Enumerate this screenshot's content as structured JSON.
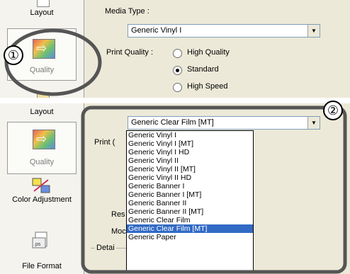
{
  "top": {
    "sidebar": {
      "layout_label": "Layout",
      "quality_label": "Quality"
    },
    "media_type_label": "Media Type :",
    "media_type_value": "Generic Vinyl I",
    "print_quality_label": "Print Quality :",
    "quality_options": [
      "High Quality",
      "Standard",
      "High Speed"
    ],
    "selected_quality": "Standard"
  },
  "bottom": {
    "sidebar": {
      "layout_label": "Layout",
      "quality_label": "Quality",
      "color_label": "Color Adjustment",
      "file_label": "File Format"
    },
    "selected_value": "Generic Clear Film [MT]",
    "media_options": [
      "Generic Vinyl I",
      "Generic Vinyl I [MT]",
      "Generic Vinyl I HD",
      "Generic Vinyl II",
      "Generic Vinyl II [MT]",
      "Generic Vinyl II HD",
      "Generic Banner I",
      "Generic Banner I [MT]",
      "Generic Banner II",
      "Generic Banner II [MT]",
      "Generic Clear Film",
      "Generic Clear Film [MT]",
      "Generic Paper"
    ],
    "partial_labels": {
      "print": "Print (",
      "res": "Res",
      "mod": "Moc",
      "detail": "Detai"
    }
  },
  "callouts": [
    "①",
    "②"
  ]
}
